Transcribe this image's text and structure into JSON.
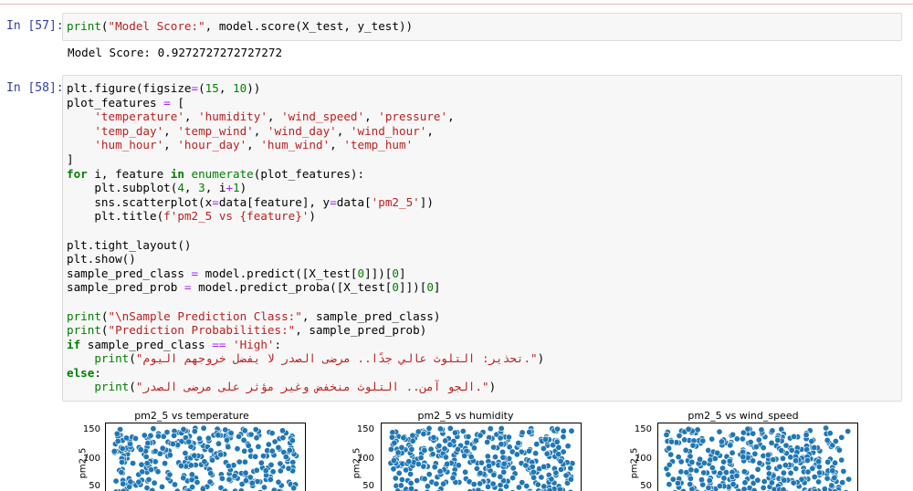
{
  "cells": [
    {
      "prompt": "In [57]:",
      "code_lines": [
        [
          [
            "n",
            "print"
          ],
          [
            "t",
            "("
          ],
          [
            "s",
            "\"Model Score:\""
          ],
          [
            "t",
            ", model.score(X_test, y_test))"
          ]
        ]
      ],
      "output": "Model Score: 0.9272727272727272"
    },
    {
      "prompt": "In [58]:",
      "code_lines": [
        [
          [
            "t",
            "plt.figure(figsize"
          ],
          [
            "o",
            "="
          ],
          [
            "t",
            "("
          ],
          [
            "m",
            "15"
          ],
          [
            "t",
            ", "
          ],
          [
            "m",
            "10"
          ],
          [
            "t",
            "))"
          ]
        ],
        [
          [
            "t",
            "plot_features "
          ],
          [
            "o",
            "="
          ],
          [
            "t",
            " ["
          ]
        ],
        [
          [
            "t",
            "    "
          ],
          [
            "s",
            "'temperature'"
          ],
          [
            "t",
            ", "
          ],
          [
            "s",
            "'humidity'"
          ],
          [
            "t",
            ", "
          ],
          [
            "s",
            "'wind_speed'"
          ],
          [
            "t",
            ", "
          ],
          [
            "s",
            "'pressure'"
          ],
          [
            "t",
            ","
          ]
        ],
        [
          [
            "t",
            "    "
          ],
          [
            "s",
            "'temp_day'"
          ],
          [
            "t",
            ", "
          ],
          [
            "s",
            "'temp_wind'"
          ],
          [
            "t",
            ", "
          ],
          [
            "s",
            "'wind_day'"
          ],
          [
            "t",
            ", "
          ],
          [
            "s",
            "'wind_hour'"
          ],
          [
            "t",
            ","
          ]
        ],
        [
          [
            "t",
            "    "
          ],
          [
            "s",
            "'hum_hour'"
          ],
          [
            "t",
            ", "
          ],
          [
            "s",
            "'hour_day'"
          ],
          [
            "t",
            ", "
          ],
          [
            "s",
            "'hum_wind'"
          ],
          [
            "t",
            ", "
          ],
          [
            "s",
            "'temp_hum'"
          ]
        ],
        [
          [
            "t",
            "]"
          ]
        ],
        [
          [
            "k",
            "for"
          ],
          [
            "t",
            " i, feature "
          ],
          [
            "k",
            "in"
          ],
          [
            "t",
            " "
          ],
          [
            "n",
            "enumerate"
          ],
          [
            "t",
            "(plot_features):"
          ]
        ],
        [
          [
            "t",
            "    plt.subplot("
          ],
          [
            "m",
            "4"
          ],
          [
            "t",
            ", "
          ],
          [
            "m",
            "3"
          ],
          [
            "t",
            ", i"
          ],
          [
            "o",
            "+"
          ],
          [
            "m",
            "1"
          ],
          [
            "t",
            ")"
          ]
        ],
        [
          [
            "t",
            "    sns.scatterplot(x"
          ],
          [
            "o",
            "="
          ],
          [
            "t",
            "data[feature], y"
          ],
          [
            "o",
            "="
          ],
          [
            "t",
            "data["
          ],
          [
            "s",
            "'pm2_5'"
          ],
          [
            "t",
            "])"
          ]
        ],
        [
          [
            "t",
            "    plt.title("
          ],
          [
            "s",
            "f'pm2_5 vs {feature}'"
          ],
          [
            "t",
            ")"
          ]
        ],
        [
          [
            "t",
            ""
          ]
        ],
        [
          [
            "t",
            "plt.tight_layout()"
          ]
        ],
        [
          [
            "t",
            "plt.show()"
          ]
        ],
        [
          [
            "t",
            "sample_pred_class "
          ],
          [
            "o",
            "="
          ],
          [
            "t",
            " model.predict([X_test["
          ],
          [
            "m",
            "0"
          ],
          [
            "t",
            "]])["
          ],
          [
            "m",
            "0"
          ],
          [
            "t",
            "]"
          ]
        ],
        [
          [
            "t",
            "sample_pred_prob "
          ],
          [
            "o",
            "="
          ],
          [
            "t",
            " model.predict_proba([X_test["
          ],
          [
            "m",
            "0"
          ],
          [
            "t",
            "]])["
          ],
          [
            "m",
            "0"
          ],
          [
            "t",
            "]"
          ]
        ],
        [
          [
            "t",
            ""
          ]
        ],
        [
          [
            "n",
            "print"
          ],
          [
            "t",
            "("
          ],
          [
            "s",
            "\"\\nSample Prediction Class:\""
          ],
          [
            "t",
            ", sample_pred_class)"
          ]
        ],
        [
          [
            "n",
            "print"
          ],
          [
            "t",
            "("
          ],
          [
            "s",
            "\"Prediction Probabilities:\""
          ],
          [
            "t",
            ", sample_pred_prob)"
          ]
        ],
        [
          [
            "k",
            "if"
          ],
          [
            "t",
            " sample_pred_class "
          ],
          [
            "o",
            "=="
          ],
          [
            "t",
            " "
          ],
          [
            "s",
            "'High'"
          ],
          [
            "t",
            ":"
          ]
        ],
        [
          [
            "t",
            "    "
          ],
          [
            "n",
            "print"
          ],
          [
            "t",
            "("
          ],
          [
            "s",
            "\"تحذير: التلوث عالي جدًا.. مرضى الصدر لا يفضل خروجهم اليوم.\""
          ],
          [
            "t",
            ")"
          ]
        ],
        [
          [
            "k",
            "else"
          ],
          [
            "t",
            ":"
          ]
        ],
        [
          [
            "t",
            "    "
          ],
          [
            "n",
            "print"
          ],
          [
            "t",
            "("
          ],
          [
            "s",
            "\"الجو آمن.. التلوث منخفض وغير مؤثر على مرضى الصدر.\""
          ],
          [
            "t",
            ")"
          ]
        ]
      ]
    }
  ],
  "plots": [
    {
      "title": "pm2_5 vs temperature",
      "ylabel": "pm2_5",
      "yticks": [
        "150",
        "100",
        "50"
      ]
    },
    {
      "title": "pm2_5 vs humidity",
      "ylabel": "pm2_5",
      "yticks": [
        "150",
        "100",
        "50"
      ]
    },
    {
      "title": "pm2_5 vs wind_speed",
      "ylabel": "pm2_5",
      "yticks": [
        "150",
        "100",
        "50"
      ]
    }
  ],
  "colors": {
    "point": "#1f77b4",
    "prompt": "#303f9f"
  }
}
